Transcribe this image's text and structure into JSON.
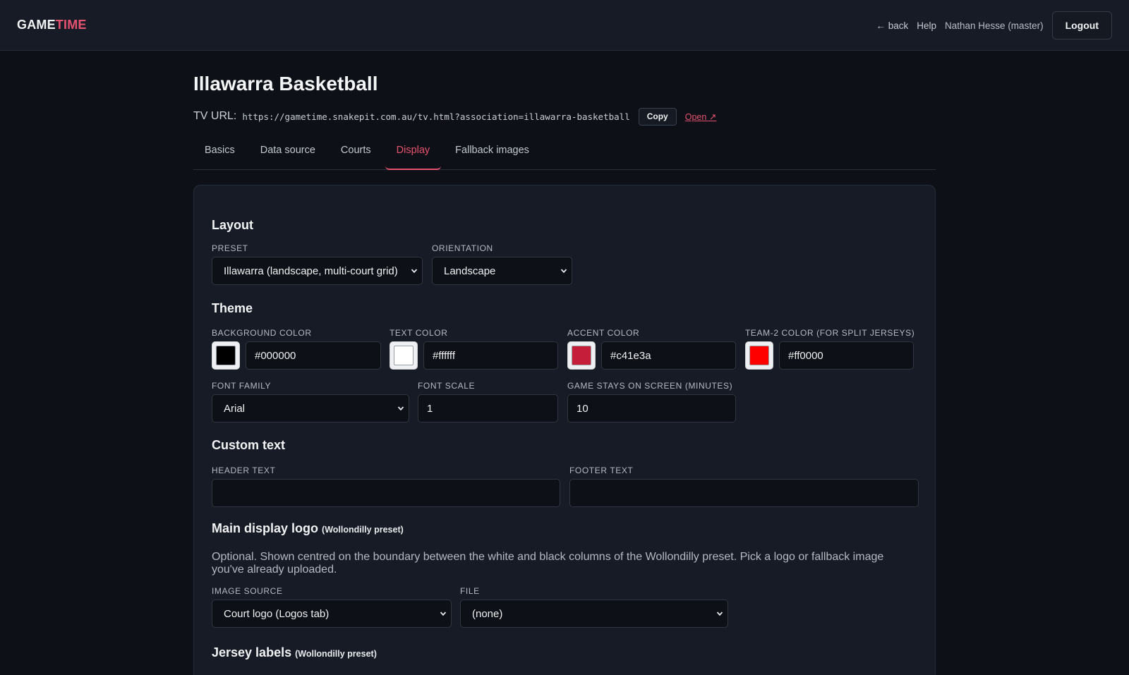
{
  "brand": {
    "part1": "GAME",
    "part2": "TIME"
  },
  "nav": {
    "back": "← back",
    "help": "Help",
    "user": "Nathan Hesse (master)",
    "logout": "Logout"
  },
  "page": {
    "title": "Illawarra Basketball",
    "tv_url_label": "TV URL:",
    "tv_url": "https://gametime.snakepit.com.au/tv.html?association=illawarra-basketball",
    "copy_label": "Copy",
    "open_label": "Open ↗"
  },
  "tabs": [
    {
      "label": "Basics",
      "active": false
    },
    {
      "label": "Data source",
      "active": false
    },
    {
      "label": "Courts",
      "active": false
    },
    {
      "label": "Display",
      "active": true
    },
    {
      "label": "Fallback images",
      "active": false
    }
  ],
  "layout": {
    "heading": "Layout",
    "preset_label": "Preset",
    "preset_value": "Illawarra (landscape, multi-court grid)",
    "orientation_label": "Orientation",
    "orientation_value": "Landscape"
  },
  "theme": {
    "heading": "Theme",
    "background_label": "Background color",
    "background_value": "#000000",
    "text_label": "Text color",
    "text_value": "#ffffff",
    "accent_label": "Accent color",
    "accent_value": "#c41e3a",
    "team2_label": "Team-2 color (for split jerseys)",
    "team2_value": "#ff0000",
    "font_family_label": "Font family",
    "font_family_value": "Arial",
    "font_scale_label": "Font scale",
    "font_scale_value": "1",
    "game_stays_label": "Game stays on screen (minutes)",
    "game_stays_value": "10"
  },
  "custom_text": {
    "heading": "Custom text",
    "header_label": "Header text",
    "header_value": "",
    "footer_label": "Footer text",
    "footer_value": ""
  },
  "main_logo": {
    "heading": "Main display logo",
    "heading_note": "(Wollondilly preset)",
    "description": "Optional. Shown centred on the boundary between the white and black columns of the Wollondilly preset. Pick a logo or fallback image you've already uploaded.",
    "image_source_label": "Image source",
    "image_source_value": "Court logo (Logos tab)",
    "file_label": "File",
    "file_value": "(none)"
  },
  "jersey_labels": {
    "heading": "Jersey labels",
    "heading_note": "(Wollondilly preset)"
  },
  "colors": {
    "accent": "#e5526f",
    "panel": "#161b25",
    "page_bg": "#0d1117"
  }
}
